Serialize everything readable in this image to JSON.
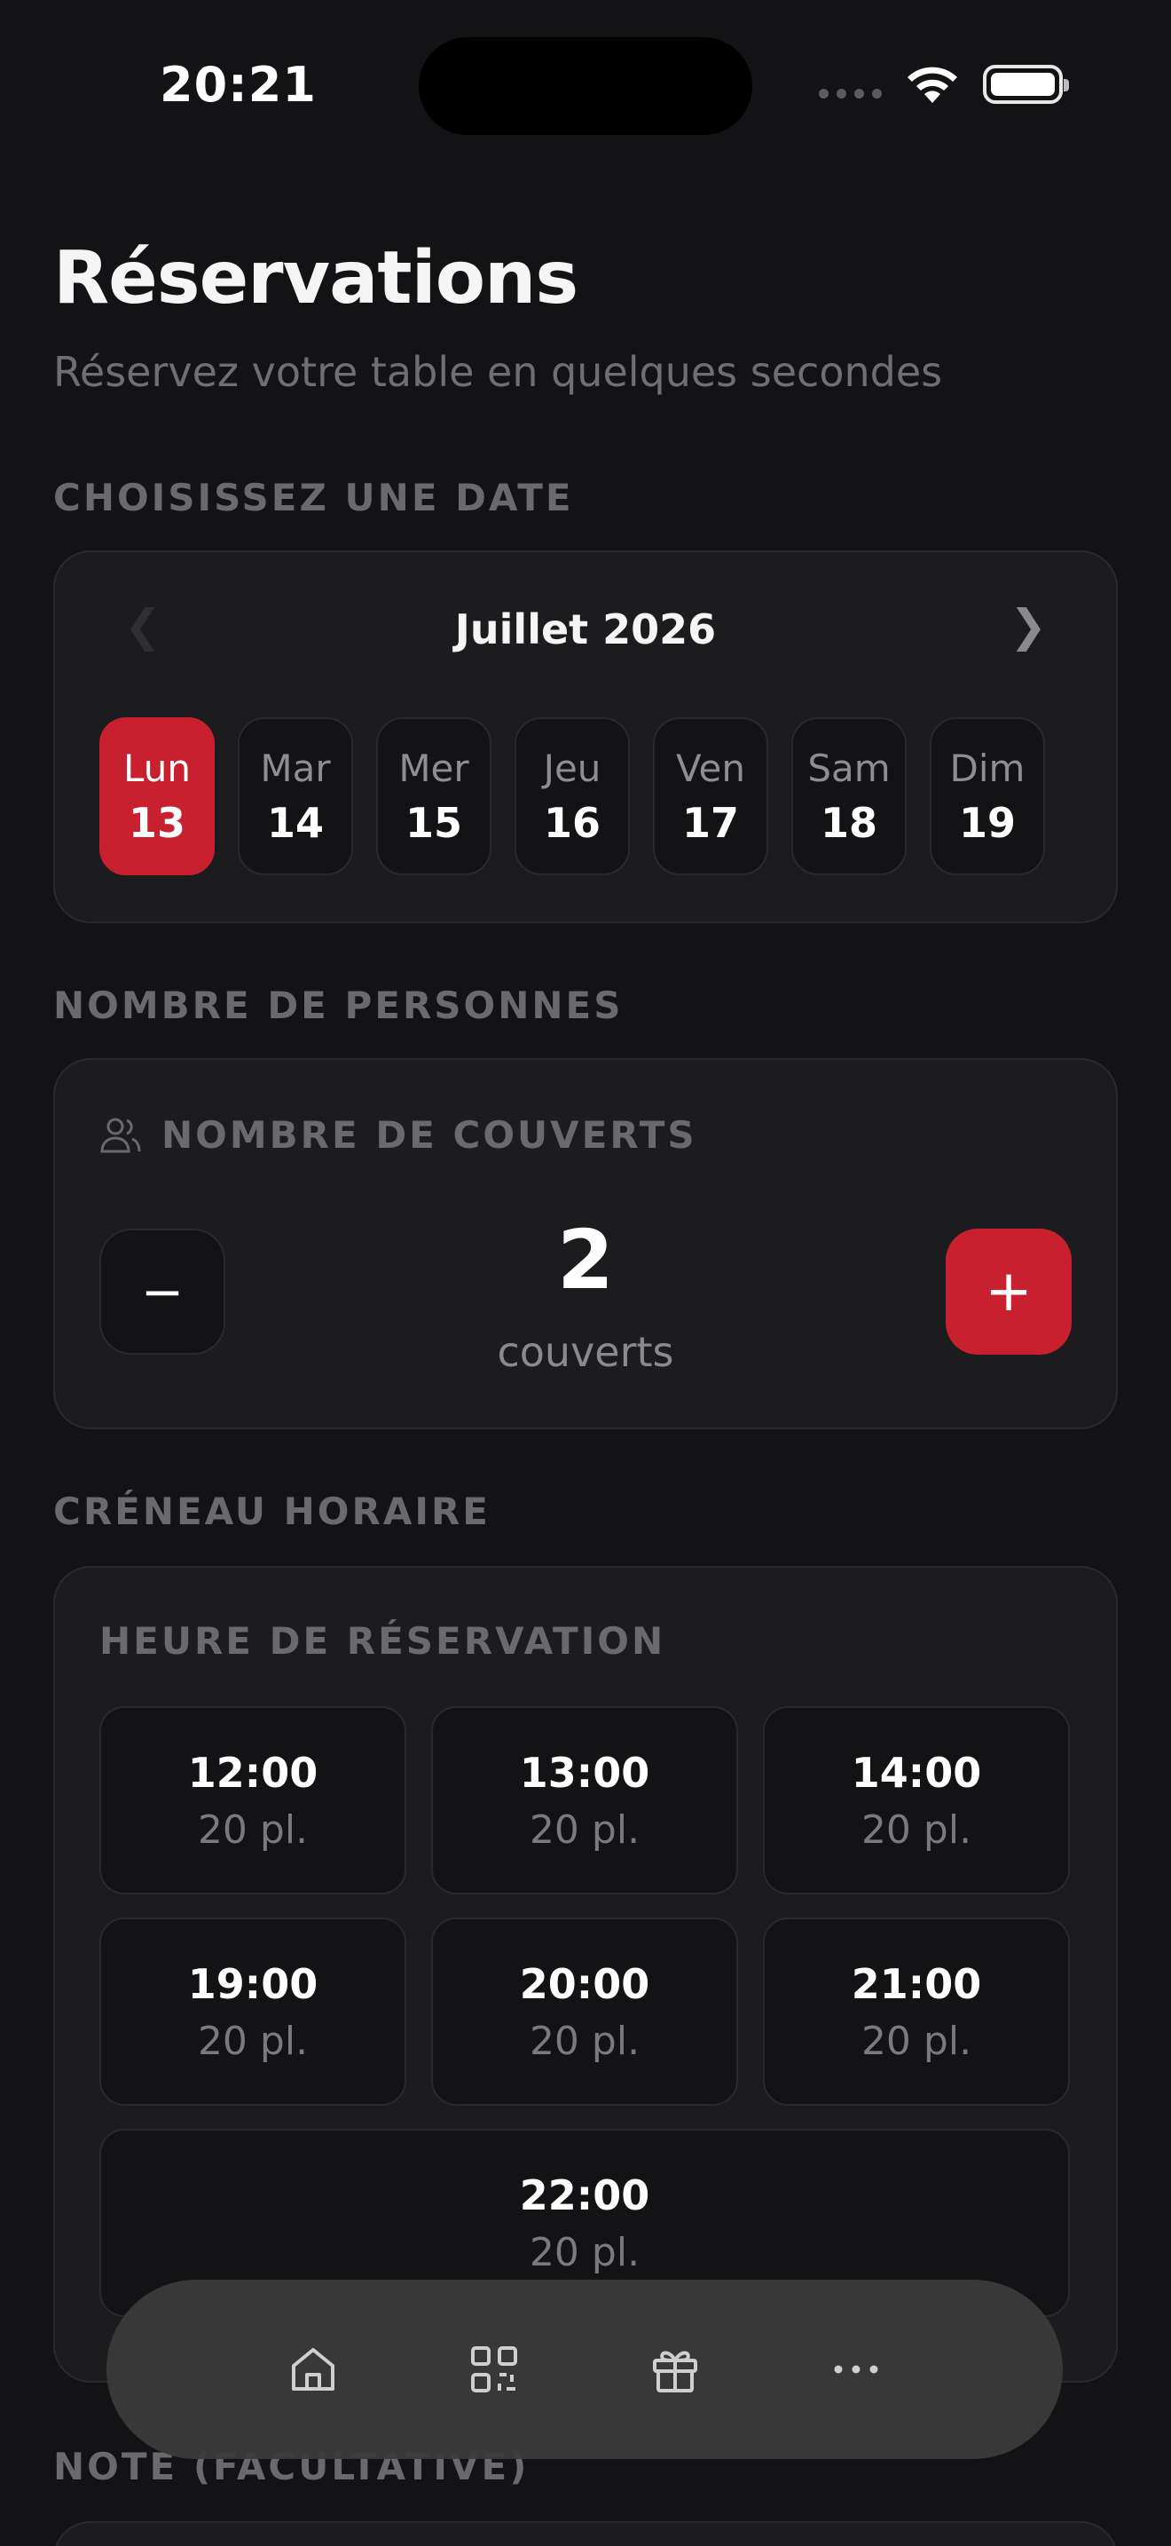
{
  "status": {
    "time": "20:21"
  },
  "header": {
    "title": "Réservations",
    "subtitle": "Réservez votre table en quelques secondes"
  },
  "date_section": {
    "label": "CHOISISSEZ UNE DATE",
    "month": "Juillet 2026",
    "days": [
      {
        "name": "Lun",
        "num": "13",
        "selected": true
      },
      {
        "name": "Mar",
        "num": "14"
      },
      {
        "name": "Mer",
        "num": "15"
      },
      {
        "name": "Jeu",
        "num": "16"
      },
      {
        "name": "Ven",
        "num": "17"
      },
      {
        "name": "Sam",
        "num": "18"
      },
      {
        "name": "Dim",
        "num": "19"
      }
    ]
  },
  "guests_section": {
    "label": "NOMBRE DE PERSONNES",
    "title": "NOMBRE DE COUVERTS",
    "minus": "−",
    "plus": "+",
    "count": "2",
    "unit": "couverts"
  },
  "slots_section": {
    "label": "CRÉNEAU HORAIRE",
    "title": "HEURE DE RÉSERVATION",
    "slots": [
      {
        "time": "12:00",
        "places": "20 pl."
      },
      {
        "time": "13:00",
        "places": "20 pl."
      },
      {
        "time": "14:00",
        "places": "20 pl."
      },
      {
        "time": "19:00",
        "places": "20 pl."
      },
      {
        "time": "20:00",
        "places": "20 pl."
      },
      {
        "time": "21:00",
        "places": "20 pl."
      },
      {
        "time": "22:00",
        "places": "20 pl."
      }
    ]
  },
  "note_section": {
    "label": "NOTE (FACULTATIVE)"
  },
  "bottom_nav": {
    "items": [
      {
        "icon": "home-icon"
      },
      {
        "icon": "qr-code-icon"
      },
      {
        "icon": "gift-icon"
      },
      {
        "icon": "more-icon"
      }
    ]
  },
  "colors": {
    "accent": "#c8202f",
    "background": "#131315",
    "card": "#1c1c1e"
  }
}
